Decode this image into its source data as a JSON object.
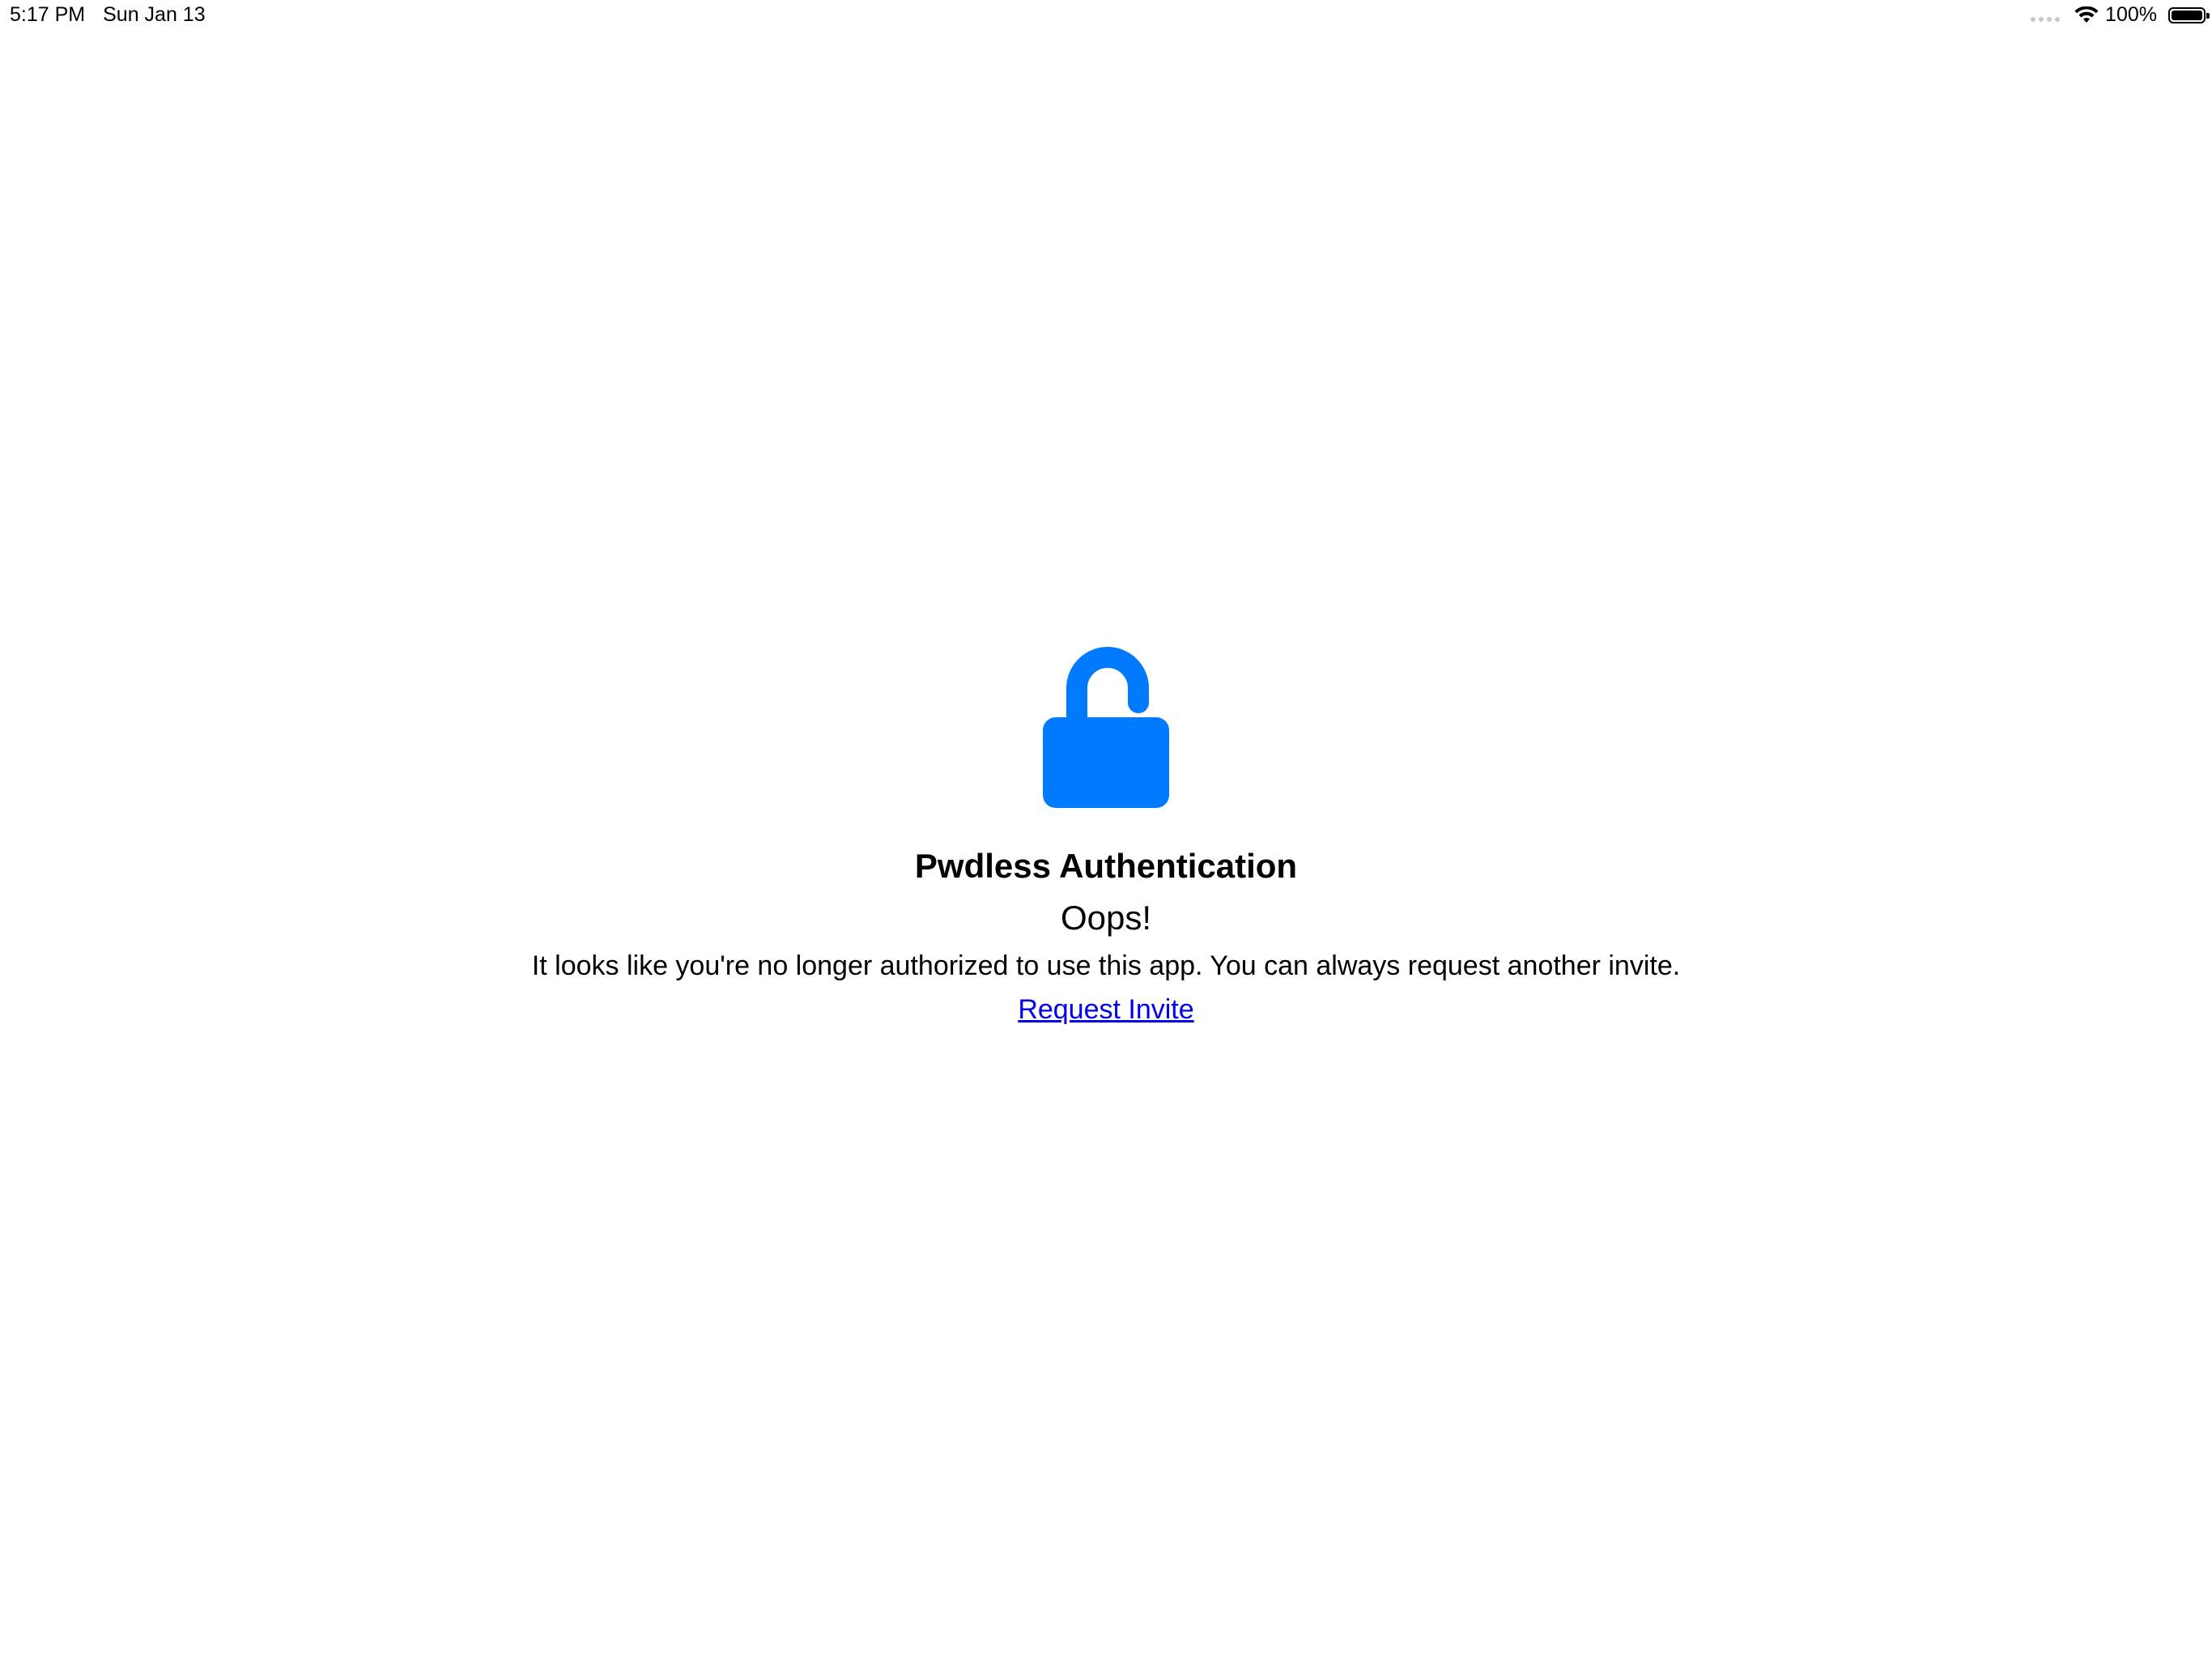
{
  "status_bar": {
    "time": "5:17 PM",
    "date": "Sun Jan 13",
    "battery_percent": "100%",
    "battery_level": 1.0,
    "icons": [
      "cellular-signal-icon",
      "wifi-icon",
      "battery-icon"
    ]
  },
  "main": {
    "icon": "unlocked-padlock-icon",
    "icon_color": "#007aff",
    "title": "Pwdless Authentication",
    "subtitle": "Oops!",
    "message": "It looks like you're no longer authorized to use this app.  You can always request another invite.",
    "link_label": "Request Invite",
    "link_color": "#0000ee"
  }
}
